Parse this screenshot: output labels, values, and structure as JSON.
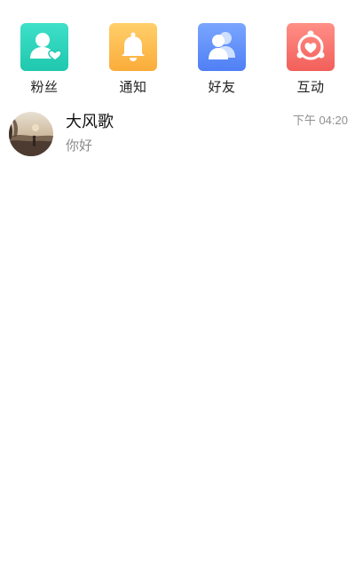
{
  "shortcuts": [
    {
      "label": "粉丝",
      "icon": "fans-icon",
      "color_top": "#3ee0c8",
      "color_bottom": "#1fc8ae"
    },
    {
      "label": "通知",
      "icon": "bell-icon",
      "color_top": "#ffcf6a",
      "color_bottom": "#fbac3a"
    },
    {
      "label": "好友",
      "icon": "friends-icon",
      "color_top": "#7aa6ff",
      "color_bottom": "#4f7ff5"
    },
    {
      "label": "互动",
      "icon": "interaction-heart-icon",
      "color_top": "#ff8f86",
      "color_bottom": "#f25f5a"
    }
  ],
  "conversations": [
    {
      "name": "大风歌",
      "message": "你好",
      "time": "下午 04:20",
      "avatar": "user-avatar"
    }
  ]
}
